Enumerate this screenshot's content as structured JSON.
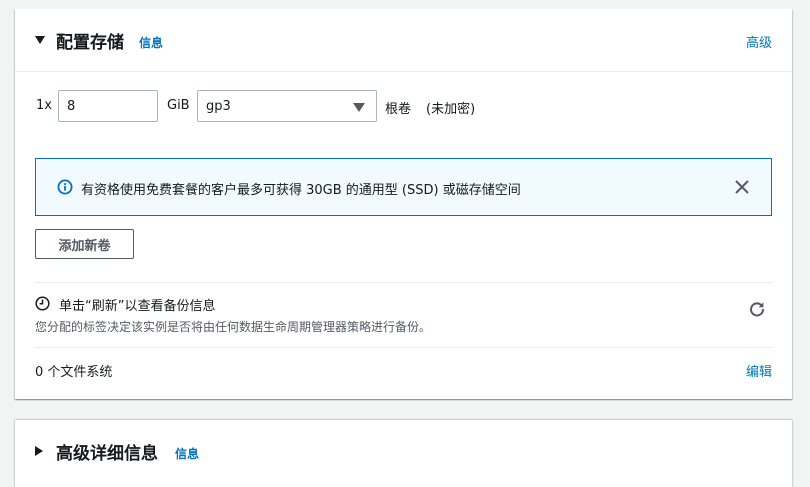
{
  "storage": {
    "title": "配置存储",
    "info_label": "信息",
    "advanced_label": "高级",
    "volume": {
      "count": "1x",
      "size": "8",
      "unit": "GiB",
      "type": "gp3",
      "root_label": "根卷",
      "encryption": "(未加密)"
    },
    "alert": {
      "message": "有资格使用免费套餐的客户最多可获得 30GB 的通用型 (SSD) 或磁存储空间",
      "icon": "info-icon"
    },
    "add_volume_label": "添加新卷",
    "backup": {
      "title": "单击“刷新”以查看备份信息",
      "description": "您分配的标签决定该实例是否将由任何数据生命周期管理器策略进行备份。"
    },
    "file_systems": "0 个文件系统",
    "edit_label": "编辑"
  },
  "advanced_details": {
    "title": "高级详细信息",
    "info_label": "信息"
  },
  "colors": {
    "link": "#0073bb",
    "alert_bg": "#f1faff",
    "alert_border": "#0073bb",
    "page_bg": "#f2f3f3"
  }
}
